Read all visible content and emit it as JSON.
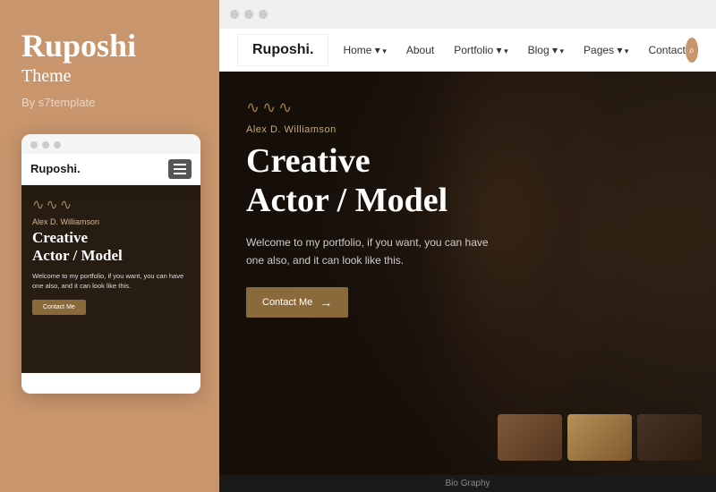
{
  "sidebar": {
    "title": "Ruposhi",
    "subtitle": "Theme",
    "by_text": "By s7template"
  },
  "mobile_preview": {
    "dots_label": "window-controls",
    "logo": "Ruposhi.",
    "wave": "∿∿∿",
    "hero_name": "Alex D. Williamson",
    "hero_title_line1": "Creative",
    "hero_title_line2": "Actor / Model",
    "hero_description": "Welcome to my portfolio, if you want, you can have one also, and it can look like this.",
    "cta_button": "Contact Me"
  },
  "desktop_preview": {
    "nav": {
      "logo": "Ruposhi.",
      "links": [
        {
          "label": "Home",
          "has_arrow": true
        },
        {
          "label": "About",
          "has_arrow": false
        },
        {
          "label": "Portfolio",
          "has_arrow": true
        },
        {
          "label": "Blog",
          "has_arrow": true
        },
        {
          "label": "Pages",
          "has_arrow": true
        },
        {
          "label": "Contact",
          "has_arrow": false
        }
      ],
      "search_icon": "🔍"
    },
    "hero": {
      "wave": "∿∿∿",
      "name": "Alex D. Williamson",
      "title_line1": "Creative",
      "title_line2": "Actor / Model",
      "description": "Welcome to my portfolio, if you want, you can have one also, and it can look like this.",
      "cta_label": "Contact Me",
      "cta_arrow": "→"
    },
    "bio_strip_label": "Bio Graphy"
  },
  "colors": {
    "sidebar_bg": "#c8956c",
    "accent": "#8a6a3a",
    "hero_bg": "#2a1e14"
  }
}
